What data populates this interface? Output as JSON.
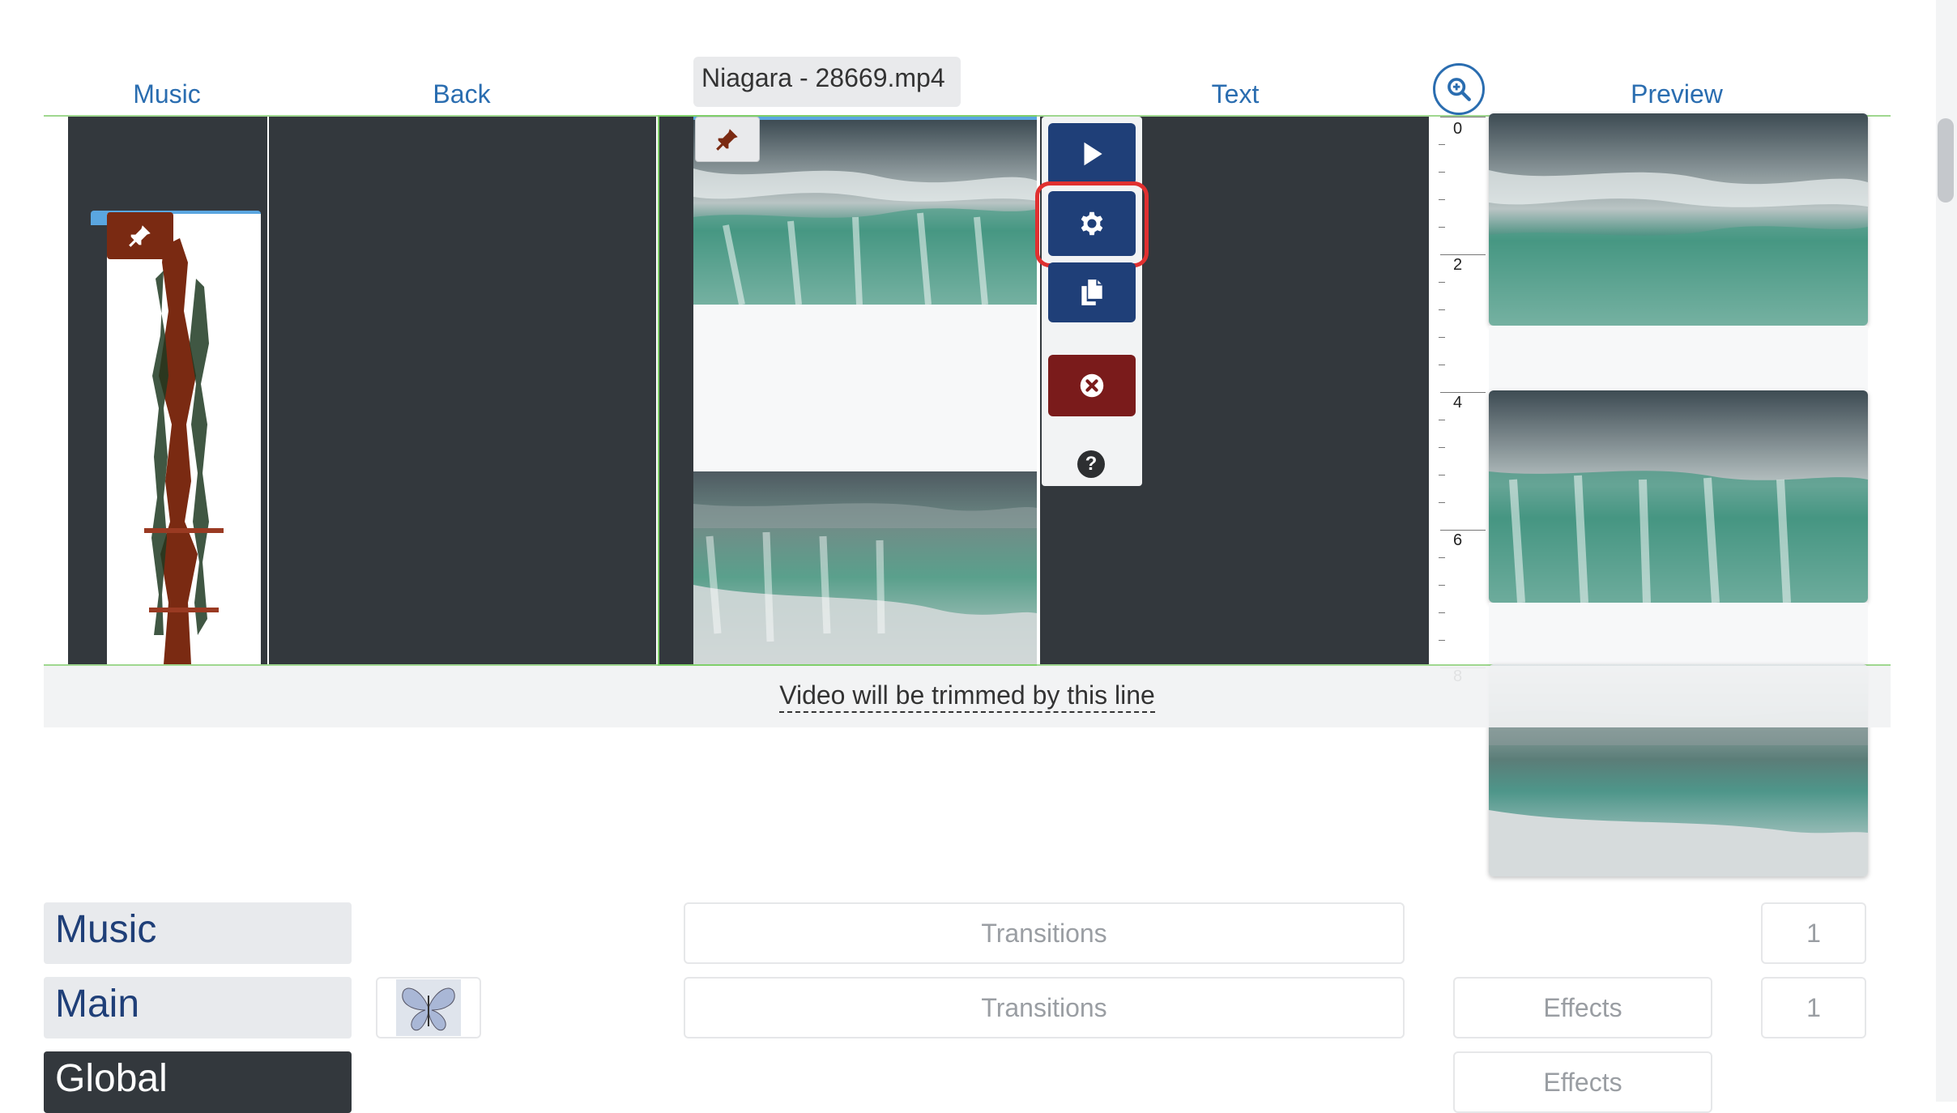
{
  "headers": {
    "music": "Music",
    "back": "Back",
    "text": "Text",
    "preview": "Preview"
  },
  "clip": {
    "filename": "Niagara - 28669.mp4"
  },
  "ruler": {
    "labels": [
      "0",
      "2",
      "4",
      "6",
      "8"
    ]
  },
  "trim": {
    "message": "Video will be trimmed by this line"
  },
  "tracks": {
    "music_label": "Music",
    "main_label": "Main",
    "global_label": "Global",
    "music_transitions": "Transitions",
    "main_transitions": "Transitions",
    "main_effects": "Effects",
    "global_effects": "Effects",
    "music_count": "1",
    "main_count": "1"
  },
  "icons": {
    "pin": "pin-icon",
    "play": "play-icon",
    "settings": "gear-icon",
    "copy": "copy-icon",
    "delete": "delete-icon",
    "help": "help-icon",
    "zoom": "zoom-in-icon",
    "butterfly": "butterfly-icon"
  },
  "colors": {
    "lane": "#33383d",
    "accent": "#2a6db0",
    "navy": "#1f3f78",
    "delete": "#7a1b1b",
    "highlight": "#e03030",
    "timeline_line": "#9fd78f",
    "music_bar": "#7a2a12"
  }
}
